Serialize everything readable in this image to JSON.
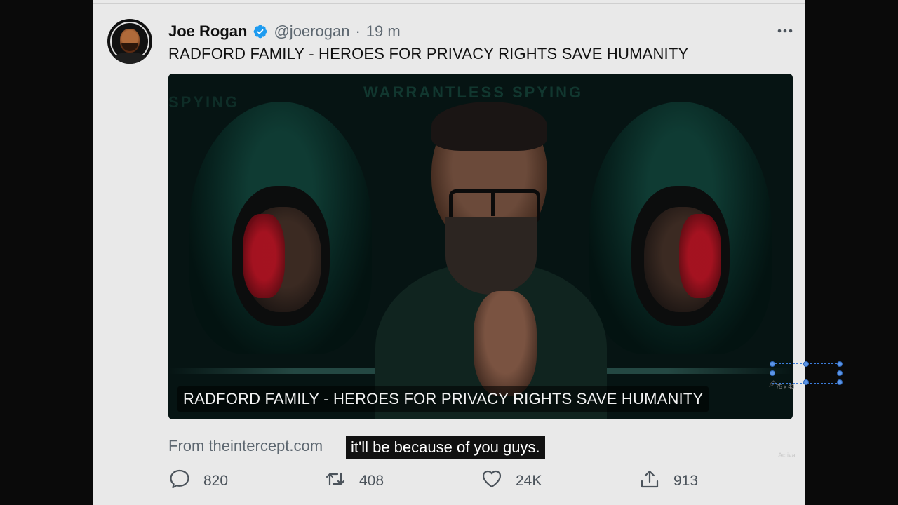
{
  "tweet": {
    "author_name": "Joe Rogan",
    "handle": "@joerogan",
    "separator": "·",
    "time": "19 m",
    "text": "RADFORD FAMILY - HEROES FOR PRIVACY RIGHTS SAVE HUMANITY",
    "source": "From theintercept.com",
    "media": {
      "caption": "RADFORD FAMILY - HEROES FOR PRIVACY RIGHTS SAVE HUMANITY",
      "background_text_1": "WARRANTLESS SPYING",
      "background_text_2": "SPYING"
    },
    "actions": {
      "replies": "820",
      "retweets": "408",
      "likes": "24K",
      "shares": "913"
    }
  },
  "video_subtitle": "it'll be because of you guys.",
  "overlay": {
    "selection_size": "75 x 43",
    "watermark": "Activa"
  },
  "icons": {
    "verified": "verified-badge-icon",
    "more": "more-dots-icon",
    "reply": "reply-icon",
    "retweet": "retweet-icon",
    "like": "heart-icon",
    "share": "share-icon"
  },
  "colors": {
    "verified": "#1d9bf0",
    "text": "#111111",
    "muted": "#5d6770",
    "frame_bg": "#e9e9e9",
    "outer_bg": "#0a0a0a"
  }
}
